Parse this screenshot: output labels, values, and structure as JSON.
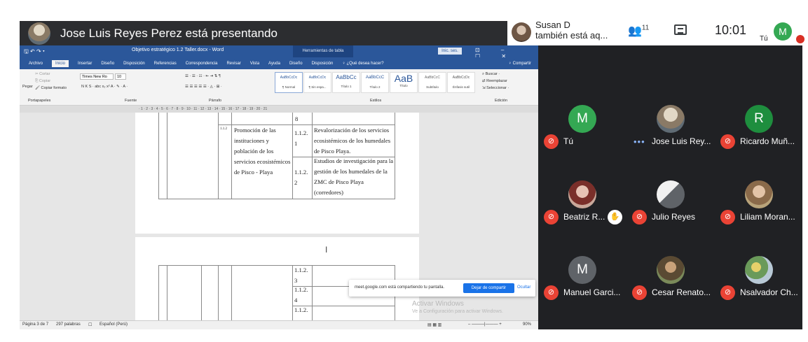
{
  "presenter": {
    "text": "Jose Luis Reyes Perez está presentando"
  },
  "notification": {
    "line1": "Susan D",
    "line2": "también está aq..."
  },
  "controls": {
    "people_icon": "people-icon",
    "people_count": "11",
    "chat_icon": "chat-icon",
    "time": "10:01",
    "self_label": "Tú",
    "self_initial": "M"
  },
  "word": {
    "quick_access": "🖫 ↶ ↷ ▾",
    "title": "Objetivo estratégico 1.2 Taller.docx - Word",
    "context_tab": "Herramientas de tabla",
    "signin": "Inic. ses.",
    "window_controls": "⊡ – ☐ ✕",
    "menu": [
      "Archivo",
      "Inicio",
      "Insertar",
      "Diseño",
      "Disposición",
      "Referencias",
      "Correspondencia",
      "Revisar",
      "Vista",
      "Ayuda",
      "Diseño",
      "Disposición",
      "♀ ¿Qué desea hacer?"
    ],
    "share": "♀ Compartir",
    "ribbon": {
      "paste": "Pegar",
      "cut": "✂ Cortar",
      "copy": "⎘ Copiar",
      "copy_format": "🖌 Copiar formato",
      "font": "Times New Ro",
      "size": "10",
      "format_row": "N  K  S  ·  abc  x₂  x²   A · ✎ · A ·",
      "para_row1": "☰ · ☰ · ☷ · ⇤ ⇥  ⇅  ¶",
      "para_row2": "☰ ☰ ☰ ☰  ☰ ·  ◬ · ⊞ ·",
      "styles": [
        {
          "preview": "AaBbCcDc",
          "label": "¶ Normal"
        },
        {
          "preview": "AaBbCcDc",
          "label": "¶ Sin espa..."
        },
        {
          "preview": "AaBbCc",
          "label": "Título 1"
        },
        {
          "preview": "AaBbCcC",
          "label": "Título 2"
        },
        {
          "preview": "AaB",
          "label": "Título"
        },
        {
          "preview": "AaBbCcC",
          "label": "Subtítulo"
        },
        {
          "preview": "AaBbCcDc",
          "label": "Énfasis sutil"
        }
      ],
      "find": "⌕ Buscar ·",
      "replace": "⇄ Reemplazar",
      "select": "⇲ Seleccionar ·",
      "groups": [
        "Portapapeles",
        "Fuente",
        "Párrafo",
        "Estilos",
        "Edición"
      ]
    },
    "ruler": "· 1 · 2 · 3 · 4 · 5 · 6 · 7 · 8 · 9 · 10 · 11 · 12 · 13 · 14 · 15 · 16 · 17 · 18 · 19 · 20 · 21",
    "table1": {
      "row0_num": "8",
      "col_index": "1.1.2",
      "action": [
        "Promoción de las",
        "instituciones y",
        "población de los",
        "servicios ecosistémicos",
        "de Pisco - Playa"
      ],
      "code1": [
        "1.1.2.",
        "1"
      ],
      "task1": [
        "Revalorización de los servicios",
        "ecosistémicos de los humedales",
        "de Pisco Playa."
      ],
      "code2": [
        "1.1.2.",
        "2"
      ],
      "task2": [
        "Estudios de investigación para la",
        "gestión de los humedales de la",
        "ZMC de Pisco Playa",
        "(corredores)"
      ]
    },
    "table2": {
      "codes": [
        [
          "1.1.2.",
          "3"
        ],
        [
          "1.1.2.",
          "4"
        ],
        [
          "1.1.2.",
          ""
        ]
      ]
    },
    "status": {
      "page": "Página 3 de 7",
      "words": "297 palabras",
      "lang": "Español (Perú)",
      "zoom": "90%"
    },
    "share_popup": {
      "message": "meet.google.com está compartiendo tu pantalla.",
      "stop": "Dejar de compartir",
      "hide": "Ocultar"
    },
    "activate": {
      "title": "Activar Windows",
      "subtitle": "Ve a Configuración para activar Windows."
    }
  },
  "participants": [
    {
      "name": "Tú",
      "initial": "M",
      "avatar_color": "#34a853",
      "muted": true
    },
    {
      "name": "Jose Luis Rey...",
      "initial": "",
      "avatar_color": "#8a7a66",
      "muted": false,
      "speaking_icon": "more-dots-icon"
    },
    {
      "name": "Ricardo Muñ...",
      "initial": "R",
      "avatar_color": "#1e8e3e",
      "muted": true
    },
    {
      "name": "Beatriz R...",
      "initial": "",
      "avatar_color": "#c06a5a",
      "muted": true,
      "hand_raised": true
    },
    {
      "name": "Julio Reyes",
      "initial": "",
      "avatar_color": "#9aa0a6",
      "muted": true
    },
    {
      "name": "Liliam Moran...",
      "initial": "",
      "avatar_color": "#b08a6a",
      "muted": true
    },
    {
      "name": "Manuel Garci...",
      "initial": "M",
      "avatar_color": "#5f6368",
      "muted": true
    },
    {
      "name": "Cesar Renato...",
      "initial": "",
      "avatar_color": "#7a6b4e",
      "muted": true
    },
    {
      "name": "Nsalvador Ch...",
      "initial": "",
      "avatar_color": "#8e9a7b",
      "muted": true
    }
  ],
  "icons": {
    "mic_off": "mic-off-icon",
    "hand": "raised-hand-icon"
  }
}
